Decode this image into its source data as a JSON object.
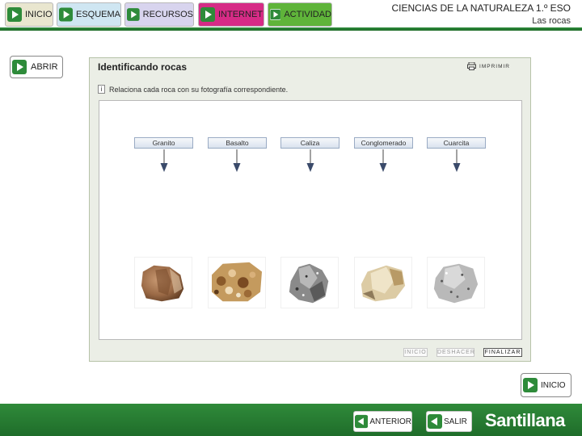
{
  "nav": {
    "inicio": "INICIO",
    "esquema": "ESQUEMA",
    "recursos": "RECURSOS",
    "internet": "INTERNET",
    "actividad": "ACTIVIDAD"
  },
  "header": {
    "title": "CIENCIAS DE LA NATURALEZA 1.º ESO",
    "subtitle": "Las rocas"
  },
  "abrir_label": "ABRIR",
  "activity": {
    "title": "Identificando rocas",
    "print_label": "IMPRIMIR",
    "instruction": "Relaciona cada roca con su fotografía correspondiente.",
    "info_glyph": "i",
    "labels": [
      "Granito",
      "Basalto",
      "Caliza",
      "Conglomerado",
      "Cuarcita"
    ],
    "rock_icons": [
      "rock-photo-brown",
      "rock-photo-conglomerate",
      "rock-photo-gray-dark",
      "rock-photo-cream",
      "rock-photo-gray-light"
    ],
    "buttons": {
      "inicio": "INICIO",
      "deshacer": "DESHACER",
      "finalizar": "FINALIZAR"
    }
  },
  "inicio_bottom": "INICIO",
  "footer": {
    "anterior": "ANTERIOR",
    "salir": "SALIR",
    "brand": "Santillana"
  },
  "colors": {
    "green_bar": "#2e8b3a",
    "internet": "#d62b86",
    "actividad": "#5fb43a",
    "panel_bg": "#ebeee6"
  }
}
